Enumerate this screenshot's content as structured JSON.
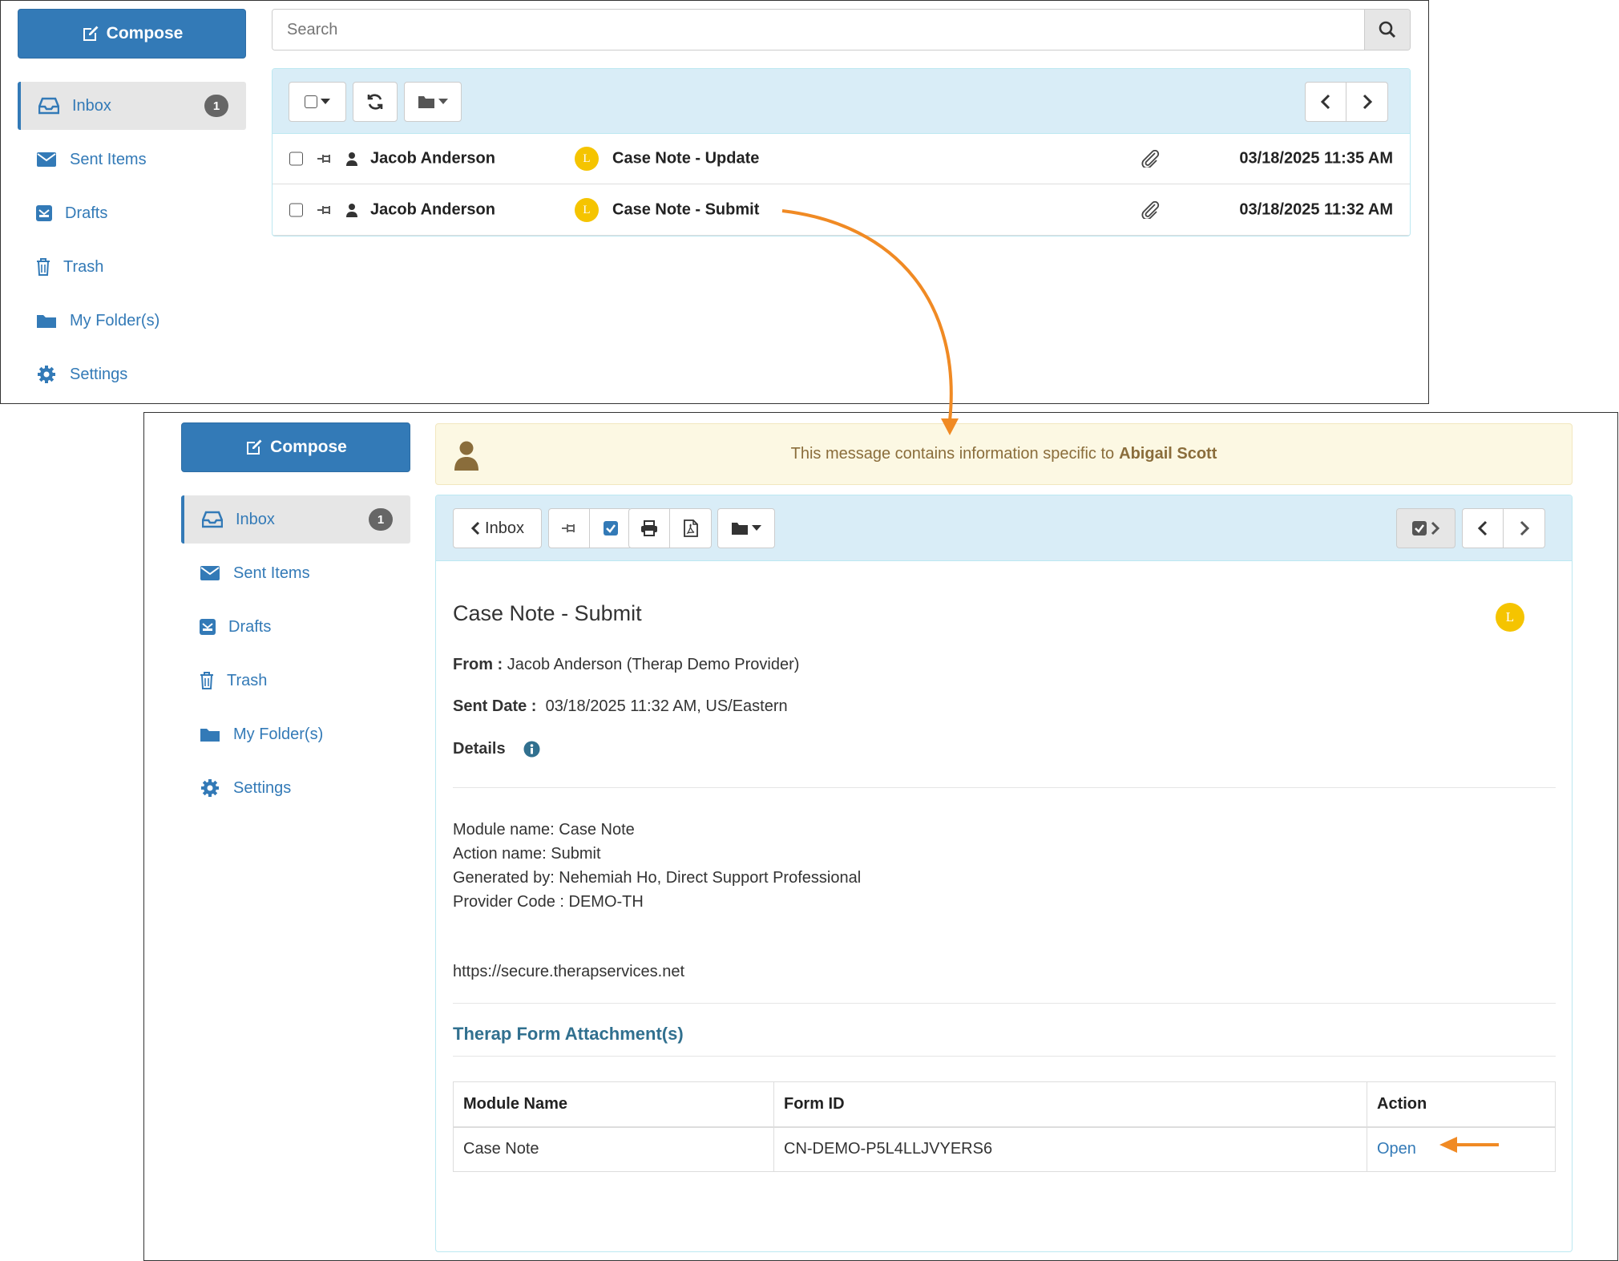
{
  "sidebar": {
    "compose_label": "Compose",
    "items": [
      {
        "label": "Inbox",
        "badge": "1"
      },
      {
        "label": "Sent Items"
      },
      {
        "label": "Drafts"
      },
      {
        "label": "Trash"
      },
      {
        "label": "My Folder(s)"
      },
      {
        "label": "Settings"
      }
    ]
  },
  "search": {
    "placeholder": "Search",
    "value": ""
  },
  "inbox": {
    "rows": [
      {
        "sender": "Jacob Anderson",
        "priority": "L",
        "subject": "Case Note - Update",
        "date": "03/18/2025 11:35 AM"
      },
      {
        "sender": "Jacob Anderson",
        "priority": "L",
        "subject": "Case Note - Submit",
        "date": "03/18/2025 11:32 AM"
      }
    ]
  },
  "notice": {
    "text": "This message contains information specific to",
    "name": "Abigail Scott"
  },
  "toolbar": {
    "back_label": "Inbox"
  },
  "message": {
    "subject": "Case Note - Submit",
    "priority": "L",
    "from_label": "From :",
    "from_value": "Jacob Anderson (Therap Demo Provider)",
    "sent_label": "Sent Date :",
    "sent_value": "03/18/2025 11:32 AM, US/Eastern",
    "details_label": "Details",
    "body_lines": [
      "Module name: Case Note",
      "Action name: Submit",
      "Generated by: Nehemiah Ho, Direct Support Professional",
      "Provider Code : DEMO-TH"
    ],
    "link": "https://secure.therapservices.net"
  },
  "attachments": {
    "title": "Therap Form Attachment(s)",
    "headers": [
      "Module Name",
      "Form ID",
      "Action"
    ],
    "rows": [
      {
        "module": "Case Note",
        "form_id": "CN-DEMO-P5L4LLJVYERS6",
        "action": "Open"
      }
    ]
  },
  "colors": {
    "accent": "#337ab7",
    "toolbar_bg": "#d9edf7",
    "notice_bg": "#fcf8e3",
    "priority": "#f5c400",
    "arrow": "#f08a24"
  }
}
